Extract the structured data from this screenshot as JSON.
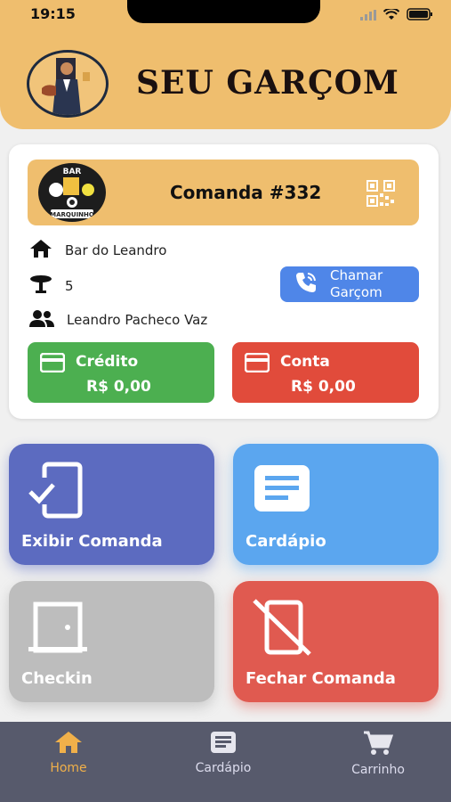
{
  "status_bar": {
    "time": "19:15"
  },
  "header": {
    "title": "SEU GARÇOM"
  },
  "comanda": {
    "title": "Comanda #332",
    "bar_name": "Bar do Leandro",
    "table_number": "5",
    "customer_name": "Leandro Pacheco Vaz",
    "call_waiter_label_line1": "Chamar",
    "call_waiter_label_line2": "Garçom",
    "bar_logo_text_top": "BAR",
    "bar_logo_text_bottom": "MARQUINHO"
  },
  "balances": {
    "credit_label": "Crédito",
    "credit_amount": "R$ 0,00",
    "conta_label": "Conta",
    "conta_amount": "R$ 0,00"
  },
  "tiles": {
    "show_comanda": "Exibir Comanda",
    "menu": "Cardápio",
    "checkin": "Checkin",
    "close_comanda": "Fechar Comanda"
  },
  "nav": {
    "home": "Home",
    "menu": "Cardápio",
    "cart": "Carrinho"
  },
  "colors": {
    "header": "#efbe6e",
    "credit": "#4caf50",
    "conta": "#e14b3b",
    "tile_show": "#5c6bc0",
    "tile_menu": "#5ba6ef",
    "tile_checkin": "#bdbdbd",
    "tile_close": "#e05a50",
    "nav_bg": "#575a6c",
    "nav_active": "#f0b04a"
  }
}
